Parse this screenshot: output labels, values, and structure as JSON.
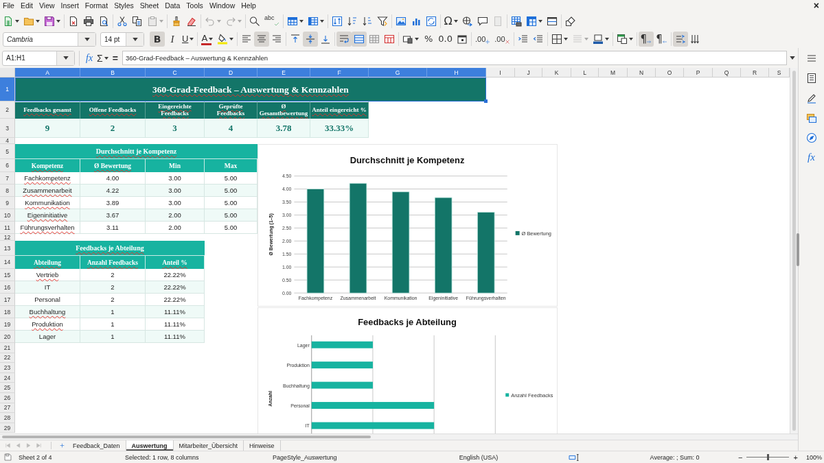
{
  "menu_bar": {
    "items": [
      "File",
      "Edit",
      "View",
      "Insert",
      "Format",
      "Styles",
      "Sheet",
      "Data",
      "Tools",
      "Window",
      "Help"
    ],
    "close_glyph": "×"
  },
  "standard_toolbar": {
    "spelling_glyph": "abc",
    "special_character_glyph": "Ω",
    "disabled": {
      "paste": true,
      "undo": true,
      "redo": true,
      "headers_and_footers": true
    }
  },
  "formatting_toolbar": {
    "font_name": "Cambria",
    "font_size": "14 pt",
    "glyph_buttons": [
      {
        "kind": "bold",
        "glyph": "B",
        "pressed": true
      },
      {
        "kind": "italic",
        "glyph": "I",
        "pressed": false
      },
      {
        "kind": "underline",
        "glyph": "U",
        "pressed": false
      }
    ],
    "font_color_glyph": "A",
    "percent_glyph": "%",
    "number_glyph": "0.0",
    "add_decimal_glyph": ".00",
    "delete_decimal_glyph": ".00",
    "paragraph_buttons": [
      {
        "kind": "ltr",
        "glyph": "¶",
        "pressed": true
      },
      {
        "kind": "rtl",
        "glyph": "¶",
        "pressed": false
      }
    ],
    "pressed": {
      "align_left": false,
      "align_center": true,
      "align_right": false,
      "align_top": false,
      "align_middle": true,
      "align_bottom": false,
      "wrap_text": true,
      "merge_and_center": true,
      "text_direction": true,
      "vertical_text": false
    },
    "disabled": {
      "border_style": true
    }
  },
  "formula_bar": {
    "name_box": "A1:H1",
    "function_wizard_glyph": "fx",
    "sum_glyph": "Σ",
    "equals_glyph": "=",
    "content": "360-Grad-Feedback – Auswertung & Kennzahlen"
  },
  "sidebar": {
    "functions_glyph": "fx"
  },
  "sheet": {
    "columns": [
      {
        "label": "A",
        "selected": true
      },
      {
        "label": "B",
        "selected": true
      },
      {
        "label": "C",
        "selected": true
      },
      {
        "label": "D",
        "selected": true
      },
      {
        "label": "E",
        "selected": true
      },
      {
        "label": "F",
        "selected": true
      },
      {
        "label": "G",
        "selected": true
      },
      {
        "label": "H",
        "selected": true
      },
      {
        "label": "I",
        "selected": false
      },
      {
        "label": "J",
        "selected": false
      },
      {
        "label": "K",
        "selected": false
      },
      {
        "label": "L",
        "selected": false
      },
      {
        "label": "M",
        "selected": false
      },
      {
        "label": "N",
        "selected": false
      },
      {
        "label": "O",
        "selected": false
      },
      {
        "label": "P",
        "selected": false
      },
      {
        "label": "Q",
        "selected": false
      },
      {
        "label": "R",
        "selected": false
      },
      {
        "label": "S",
        "selected": false
      }
    ],
    "rows": [
      {
        "label": "1",
        "selected": true
      },
      {
        "label": "2",
        "selected": false
      },
      {
        "label": "3",
        "selected": false
      },
      {
        "label": "4",
        "selected": false
      },
      {
        "label": "5",
        "selected": false
      },
      {
        "label": "6",
        "selected": false
      },
      {
        "label": "7",
        "selected": false
      },
      {
        "label": "8",
        "selected": false
      },
      {
        "label": "9",
        "selected": false
      },
      {
        "label": "10",
        "selected": false
      },
      {
        "label": "11",
        "selected": false
      },
      {
        "label": "12",
        "selected": false
      },
      {
        "label": "13",
        "selected": false
      },
      {
        "label": "14",
        "selected": false
      },
      {
        "label": "15",
        "selected": false
      },
      {
        "label": "16",
        "selected": false
      },
      {
        "label": "17",
        "selected": false
      },
      {
        "label": "18",
        "selected": false
      },
      {
        "label": "19",
        "selected": false
      },
      {
        "label": "20",
        "selected": false
      },
      {
        "label": "21",
        "selected": false
      },
      {
        "label": "22",
        "selected": false
      },
      {
        "label": "23",
        "selected": false
      },
      {
        "label": "24",
        "selected": false
      },
      {
        "label": "25",
        "selected": false
      },
      {
        "label": "26",
        "selected": false
      },
      {
        "label": "27",
        "selected": false
      },
      {
        "label": "28",
        "selected": false
      },
      {
        "label": "29",
        "selected": false
      }
    ],
    "title": {
      "text": "360-Grad-Feedback – Auswertung & Kennzahlen",
      "selected": true,
      "flagged": true
    },
    "kpis": [
      {
        "label": "Feedbacks gesamt",
        "value": "9",
        "flagged": true
      },
      {
        "label": "Offene Feedbacks",
        "value": "2",
        "flagged": true
      },
      {
        "label": "Eingereichte Feedbacks",
        "value": "3",
        "flagged": true
      },
      {
        "label": "Geprüfte Feedbacks",
        "value": "4",
        "flagged": true
      },
      {
        "label": "Ø Gesamtbewertung",
        "value": "3.78",
        "flagged": true
      },
      {
        "label": "Anteil eingereicht %",
        "value": "33.33%",
        "flagged": true
      }
    ],
    "kompetenz_table": {
      "title": "Durchschnitt je Kompetenz",
      "title_flagged": true,
      "columns": [
        {
          "label": "Kompetenz",
          "flagged": true
        },
        {
          "label": "Ø Bewertung",
          "flagged": true
        },
        {
          "label": "Min",
          "flagged": false
        },
        {
          "label": "Max",
          "flagged": false
        }
      ],
      "rows": [
        {
          "cells": [
            "Fachkompetenz",
            "4.00",
            "3.00",
            "5.00"
          ],
          "flagged": true
        },
        {
          "cells": [
            "Zusammenarbeit",
            "4.22",
            "3.00",
            "5.00"
          ],
          "flagged": true
        },
        {
          "cells": [
            "Kommunikation",
            "3.89",
            "3.00",
            "5.00"
          ],
          "flagged": true
        },
        {
          "cells": [
            "Eigeninitiative",
            "3.67",
            "2.00",
            "5.00"
          ],
          "flagged": true
        },
        {
          "cells": [
            "Führungsverhalten",
            "3.11",
            "2.00",
            "5.00"
          ],
          "flagged": true
        }
      ]
    },
    "abteilung_table": {
      "title": "Feedbacks je Abteilung",
      "title_flagged": true,
      "columns": [
        {
          "label": "Abteilung",
          "flagged": true
        },
        {
          "label": "Anzahl Feedbacks",
          "flagged": true
        },
        {
          "label": "Anteil %",
          "flagged": true
        }
      ],
      "rows": [
        {
          "cells": [
            "Vertrieb",
            "2",
            "22.22%"
          ],
          "flagged": true
        },
        {
          "cells": [
            "IT",
            "2",
            "22.22%"
          ],
          "flagged": false
        },
        {
          "cells": [
            "Personal",
            "2",
            "22.22%"
          ],
          "flagged": false
        },
        {
          "cells": [
            "Buchhaltung",
            "1",
            "11.11%"
          ],
          "flagged": true
        },
        {
          "cells": [
            "Produktion",
            "1",
            "11.11%"
          ],
          "flagged": true
        },
        {
          "cells": [
            "Lager",
            "1",
            "11.11%"
          ],
          "flagged": false
        }
      ]
    },
    "charts": [
      {
        "kind": "data",
        "chart_data": {
          "type": "bar",
          "orientation": "vertical",
          "title": "Durchschnitt je Kompetenz",
          "ylabel": "Ø Bewertung (1–5)",
          "categories": [
            "Fachkompetenz",
            "Zusammenarbeit",
            "Kommunikation",
            "Eigeninitiative",
            "Führungsverhalten"
          ],
          "series": [
            {
              "name": "Ø Bewertung",
              "color": "#137568",
              "values": [
                4.0,
                4.22,
                3.89,
                3.67,
                3.11
              ]
            }
          ],
          "ylim": [
            0,
            4.5
          ],
          "yticks": [
            {
              "value": 0,
              "label": "0.00"
            },
            {
              "value": 0.5,
              "label": "0.50"
            },
            {
              "value": 1,
              "label": "1.00"
            },
            {
              "value": 1.5,
              "label": "1.50"
            },
            {
              "value": 2,
              "label": "2.00"
            },
            {
              "value": 2.5,
              "label": "2.50"
            },
            {
              "value": 3,
              "label": "3.00"
            },
            {
              "value": 3.5,
              "label": "3.50"
            },
            {
              "value": 4,
              "label": "4.00"
            },
            {
              "value": 4.5,
              "label": "4.50"
            }
          ],
          "grid": true
        }
      },
      {
        "kind": "picture",
        "title": "Feedbacks je Abteilung",
        "ylabel": "Anzahl",
        "categories": [
          "Lager",
          "Produktion",
          "Buchhaltung",
          "Personal",
          "IT"
        ],
        "legend": "Anzahl Feedbacks"
      }
    ]
  },
  "sheet_tabs": {
    "navigation_disabled": true,
    "tabs": [
      {
        "label": "Feedback_Daten",
        "selected": false
      },
      {
        "label": "Auswertung",
        "selected": true
      },
      {
        "label": "Mitarbeiter_Übersicht",
        "selected": false
      },
      {
        "label": "Hinweise",
        "selected": false
      }
    ]
  },
  "status_bar": {
    "sheet": "Sheet 2 of 4",
    "selection": "Selected: 1 row, 8 columns",
    "page_style": "PageStyle_Auswertung",
    "language": "English (USA)",
    "aggregate": "Average: ; Sum: 0",
    "zoom": {
      "out_glyph": "−",
      "in_glyph": "+",
      "level": 0.5,
      "label": "100%"
    }
  }
}
